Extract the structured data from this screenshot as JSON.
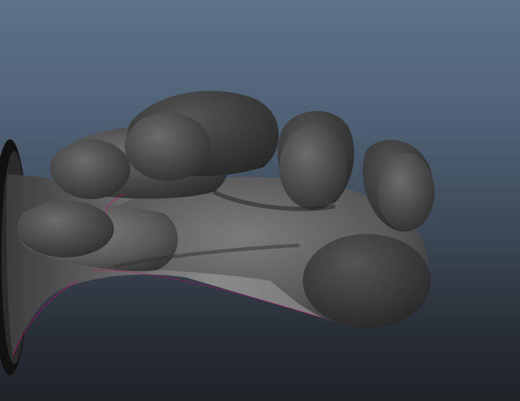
{
  "viewport": {
    "background_top": "#5e7388",
    "background_bottom": "#202328",
    "model_color": "#4a4a4a",
    "highlight_color": "#7a7a7a",
    "edge_artifact_color": "#d4007a"
  }
}
